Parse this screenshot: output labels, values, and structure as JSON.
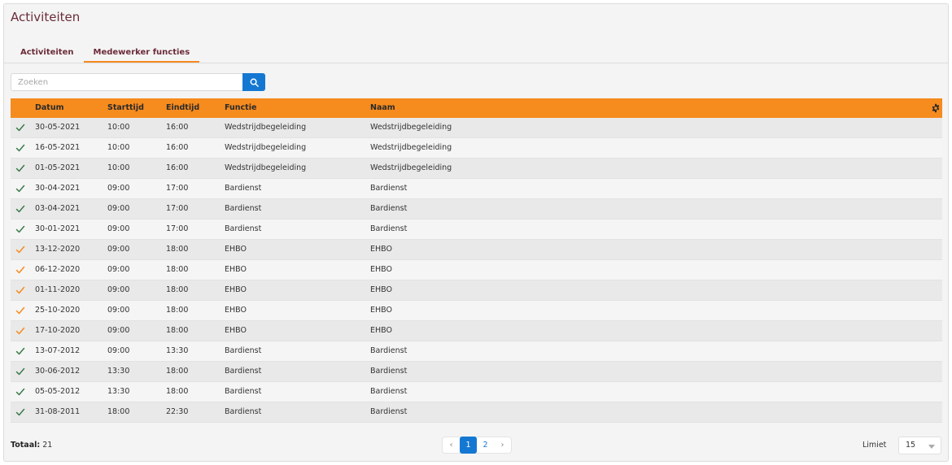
{
  "page": {
    "title": "Activiteiten"
  },
  "tabs": [
    {
      "label": "Activiteiten",
      "active": false
    },
    {
      "label": "Medewerker functies",
      "active": true
    }
  ],
  "search": {
    "placeholder": "Zoeken",
    "value": ""
  },
  "table": {
    "columns": [
      "Datum",
      "Starttijd",
      "Eindtijd",
      "Functie",
      "Naam"
    ],
    "rows": [
      {
        "status": "green",
        "date": "30-05-2021",
        "start": "10:00",
        "end": "16:00",
        "function": "Wedstrijdbegeleiding",
        "name": "Wedstrijdbegeleiding"
      },
      {
        "status": "green",
        "date": "16-05-2021",
        "start": "10:00",
        "end": "16:00",
        "function": "Wedstrijdbegeleiding",
        "name": "Wedstrijdbegeleiding"
      },
      {
        "status": "green",
        "date": "01-05-2021",
        "start": "10:00",
        "end": "16:00",
        "function": "Wedstrijdbegeleiding",
        "name": "Wedstrijdbegeleiding"
      },
      {
        "status": "green",
        "date": "30-04-2021",
        "start": "09:00",
        "end": "17:00",
        "function": "Bardienst",
        "name": "Bardienst"
      },
      {
        "status": "green",
        "date": "03-04-2021",
        "start": "09:00",
        "end": "17:00",
        "function": "Bardienst",
        "name": "Bardienst"
      },
      {
        "status": "green",
        "date": "30-01-2021",
        "start": "09:00",
        "end": "17:00",
        "function": "Bardienst",
        "name": "Bardienst"
      },
      {
        "status": "orange",
        "date": "13-12-2020",
        "start": "09:00",
        "end": "18:00",
        "function": "EHBO",
        "name": "EHBO"
      },
      {
        "status": "orange",
        "date": "06-12-2020",
        "start": "09:00",
        "end": "18:00",
        "function": "EHBO",
        "name": "EHBO"
      },
      {
        "status": "orange",
        "date": "01-11-2020",
        "start": "09:00",
        "end": "18:00",
        "function": "EHBO",
        "name": "EHBO"
      },
      {
        "status": "orange",
        "date": "25-10-2020",
        "start": "09:00",
        "end": "18:00",
        "function": "EHBO",
        "name": "EHBO"
      },
      {
        "status": "orange",
        "date": "17-10-2020",
        "start": "09:00",
        "end": "18:00",
        "function": "EHBO",
        "name": "EHBO"
      },
      {
        "status": "green",
        "date": "13-07-2012",
        "start": "09:00",
        "end": "13:30",
        "function": "Bardienst",
        "name": "Bardienst"
      },
      {
        "status": "green",
        "date": "30-06-2012",
        "start": "13:30",
        "end": "18:00",
        "function": "Bardienst",
        "name": "Bardienst"
      },
      {
        "status": "green",
        "date": "05-05-2012",
        "start": "13:30",
        "end": "18:00",
        "function": "Bardienst",
        "name": "Bardienst"
      },
      {
        "status": "green",
        "date": "31-08-2011",
        "start": "18:00",
        "end": "22:30",
        "function": "Bardienst",
        "name": "Bardienst"
      }
    ]
  },
  "footer": {
    "total_label": "Totaal:",
    "total_value": "21",
    "pages": [
      "1",
      "2"
    ],
    "current_page": "1",
    "prev_icon": "‹",
    "next_icon": "›",
    "limit_label": "Limiet",
    "limit_value": "15"
  },
  "colors": {
    "accent": "#f68b1e",
    "primary": "#1478d2",
    "title": "#6b2c3a",
    "status_green": "#3a7a4a",
    "status_orange": "#f68b1e"
  },
  "icons": {
    "search": "search-icon",
    "settings": "gear-icon",
    "status": "check-icon"
  }
}
